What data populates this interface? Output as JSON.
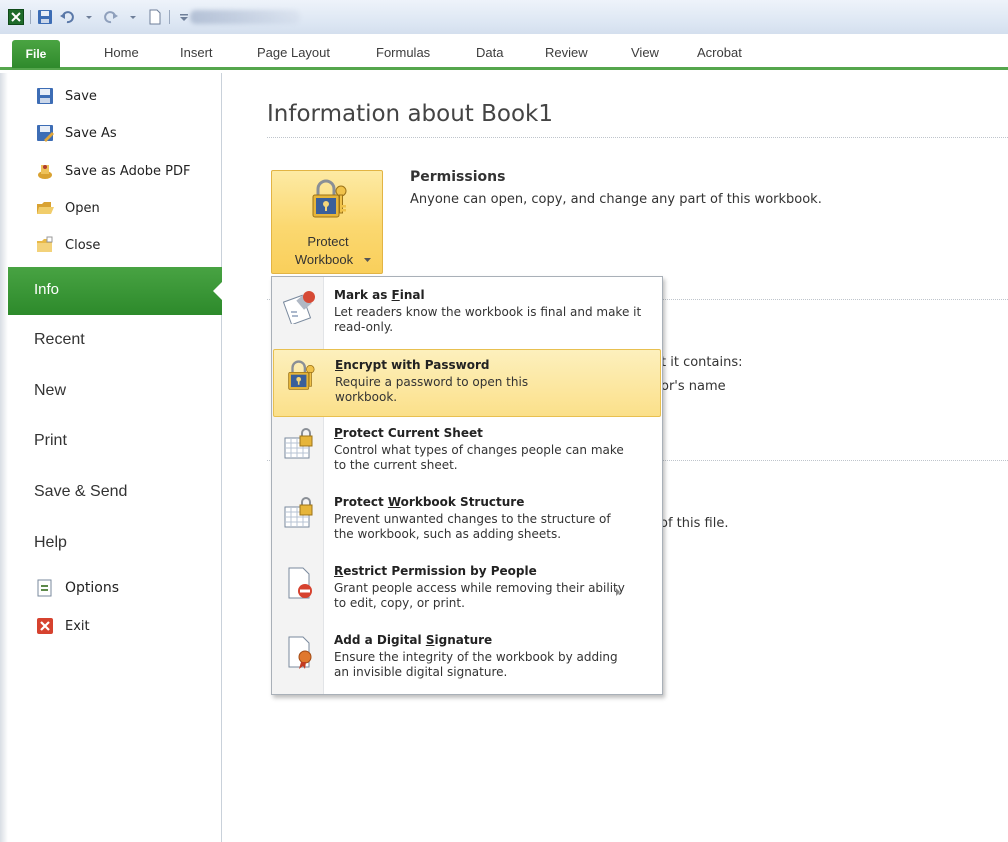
{
  "ribbon": {
    "tabs": [
      "File",
      "Home",
      "Insert",
      "Page Layout",
      "Formulas",
      "Data",
      "Review",
      "View",
      "Acrobat"
    ]
  },
  "nav": {
    "small_items": [
      "Save",
      "Save As",
      "Save as Adobe PDF",
      "Open",
      "Close"
    ],
    "selected": "Info",
    "big_items": [
      "Recent",
      "New",
      "Print",
      "Save & Send",
      "Help"
    ],
    "bottom_items": [
      "Options",
      "Exit"
    ]
  },
  "main": {
    "title": "Information about Book1",
    "protect_button": {
      "line1": "Protect",
      "line2": "Workbook"
    },
    "permissions_title": "Permissions",
    "permissions_desc": "Anyone can open, copy, and change any part of this workbook.",
    "fragments": [
      "t it contains:",
      "or's name",
      "of this file."
    ]
  },
  "menu": {
    "items": [
      {
        "pre": "Mark as ",
        "u": "F",
        "post": "inal",
        "desc": "Let readers know the workbook is final and make it read-only."
      },
      {
        "pre": "",
        "u": "E",
        "post": "ncrypt with Password",
        "desc": "Require a password to open this workbook."
      },
      {
        "pre": "",
        "u": "P",
        "post": "rotect Current Sheet",
        "desc": "Control what types of changes people can make to the current sheet."
      },
      {
        "pre": "Protect ",
        "u": "W",
        "post": "orkbook Structure",
        "desc": "Prevent unwanted changes to the structure of the workbook, such as adding sheets."
      },
      {
        "pre": "",
        "u": "R",
        "post": "estrict Permission by People",
        "desc": "Grant people access while removing their ability to edit, copy, or print."
      },
      {
        "pre": "Add a Digital ",
        "u": "S",
        "post": "ignature",
        "desc": "Ensure the integrity of the workbook by adding an invisible digital signature."
      }
    ]
  },
  "colors": {
    "accent_green": "#2f8a2c",
    "hover_gold": "#fbe08a",
    "button_gold": "#fbd870"
  },
  "icons": [
    "excel-icon",
    "save-icon",
    "undo-icon",
    "redo-icon",
    "new-icon",
    "save-as-icon",
    "pdf-icon",
    "open-folder-icon",
    "close-folder-icon",
    "options-icon",
    "exit-icon",
    "lock-key-icon",
    "mark-final-icon",
    "sheet-lock-icon",
    "restrict-icon",
    "signature-icon"
  ]
}
